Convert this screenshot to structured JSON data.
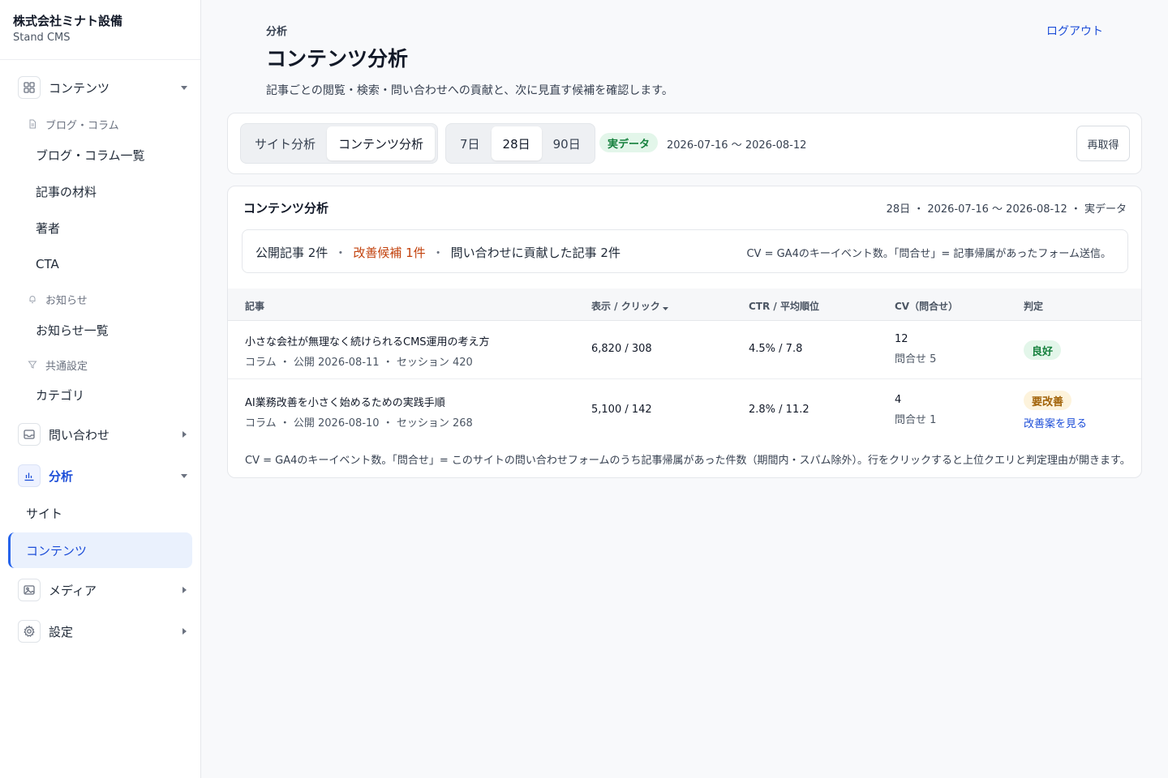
{
  "brand": {
    "name": "株式会社ミナト設備",
    "product": "Stand CMS"
  },
  "sidebar": {
    "groups": {
      "content": "コンテンツ",
      "inquiry": "問い合わせ",
      "analytics": "分析",
      "media": "メディア",
      "settings": "設定"
    },
    "sections": {
      "blog": "ブログ・コラム",
      "news": "お知らせ",
      "common": "共通設定"
    },
    "items": {
      "blog_list": "ブログ・コラム一覧",
      "materials": "記事の材料",
      "authors": "著者",
      "cta": "CTA",
      "news_list": "お知らせ一覧",
      "category": "カテゴリ",
      "site": "サイト",
      "contents": "コンテンツ"
    }
  },
  "header": {
    "breadcrumb": "分析",
    "title": "コンテンツ分析",
    "description": "記事ごとの閲覧・検索・問い合わせへの貢献と、次に見直す候補を確認します。",
    "logout": "ログアウト"
  },
  "toolbar": {
    "view_tabs": [
      "サイト分析",
      "コンテンツ分析"
    ],
    "active_view": "コンテンツ分析",
    "ranges": [
      "7日",
      "28日",
      "90日"
    ],
    "active_range": "28日",
    "data_badge": "実データ",
    "date_range": "2026-07-16 〜 2026-08-12",
    "refresh": "再取得"
  },
  "panel": {
    "title": "コンテンツ分析",
    "meta": "28日 ・ 2026-07-16 〜 2026-08-12 ・ 実データ",
    "summary": {
      "published": "公開記事 2件",
      "candidates": "改善候補 1件",
      "contributed": "問い合わせに貢献した記事 2件",
      "note": "CV = GA4のキーイベント数。「問合せ」= 記事帰属があったフォーム送信。"
    },
    "columns": {
      "article": "記事",
      "impressions": "表示 / クリック",
      "ctr": "CTR / 平均順位",
      "cv": "CV（問合せ）",
      "verdict": "判定"
    },
    "rows": [
      {
        "title": "小さな会社が無理なく続けられるCMS運用の考え方",
        "meta": "コラム ・ 公開 2026-08-11 ・ セッション 420",
        "impressions": "6,820 / 308",
        "ctr": "4.5% / 7.8",
        "cv": "12",
        "inquiry": "問合せ 5",
        "verdict": "良好",
        "action": ""
      },
      {
        "title": "AI業務改善を小さく始めるための実践手順",
        "meta": "コラム ・ 公開 2026-08-10 ・ セッション 268",
        "impressions": "5,100 / 142",
        "ctr": "2.8% / 11.2",
        "cv": "4",
        "inquiry": "問合せ 1",
        "verdict": "要改善",
        "action": "改善案を見る"
      }
    ],
    "footnote": "CV = GA4のキーイベント数。「問合せ」= このサイトの問い合わせフォームのうち記事帰属があった件数（期間内・スパム除外）。行をクリックすると上位クエリと判定理由が開きます。"
  },
  "colors": {
    "accent": "#2563eb",
    "good": "#15803d",
    "warn": "#c2410c",
    "caution": "#a16207"
  }
}
